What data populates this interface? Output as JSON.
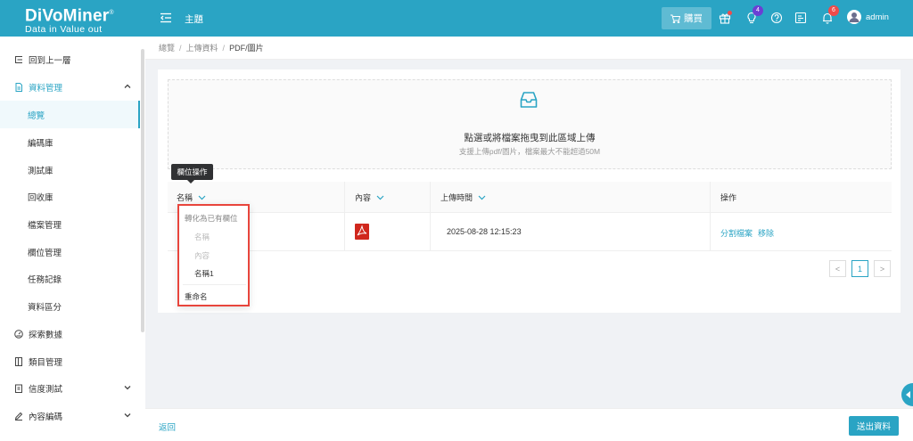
{
  "header": {
    "brand": "DiVoMiner",
    "brand_mark": "®",
    "tagline": "Data in Value out",
    "title": "主題",
    "buy_label": "購買",
    "notif_badge_1": "4",
    "notif_badge_2": "6",
    "user": "admin"
  },
  "sidebar": {
    "items": [
      {
        "label": "回到上一層"
      },
      {
        "label": "資料管理"
      },
      {
        "label": "總覽"
      },
      {
        "label": "編碼庫"
      },
      {
        "label": "測試庫"
      },
      {
        "label": "回收庫"
      },
      {
        "label": "檔案管理"
      },
      {
        "label": "欄位管理"
      },
      {
        "label": "任務記錄"
      },
      {
        "label": "資料區分"
      },
      {
        "label": "探索數據"
      },
      {
        "label": "類目管理"
      },
      {
        "label": "信度測試"
      },
      {
        "label": "內容編碼"
      }
    ]
  },
  "breadcrumb": [
    "總覽",
    "上傳資料",
    "PDF/圖片"
  ],
  "upload": {
    "text": "點選或將檔案拖曳到此區域上傳",
    "hint": "支援上傳pdf/圖片，檔案最大不能超過50M"
  },
  "table": {
    "columns": [
      "名稱",
      "內容",
      "上傳時間",
      "操作"
    ],
    "rows": [
      {
        "upload_time": "2025-08-28 12:15:23",
        "actions": [
          "分割檔案",
          "移除"
        ]
      }
    ]
  },
  "pagination": {
    "current": "1",
    "prev": "<",
    "next": ">"
  },
  "tooltip": "欄位操作",
  "dropdown": {
    "section": "轉化為已有欄位",
    "options": [
      "名稱",
      "內容",
      "名稱1"
    ],
    "rename": "重命名"
  },
  "footer": {
    "back": "返回",
    "submit": "送出資料"
  },
  "colors": {
    "primary": "#2aa4c4",
    "highlight": "#e8453c",
    "pdf": "#d0271d"
  }
}
